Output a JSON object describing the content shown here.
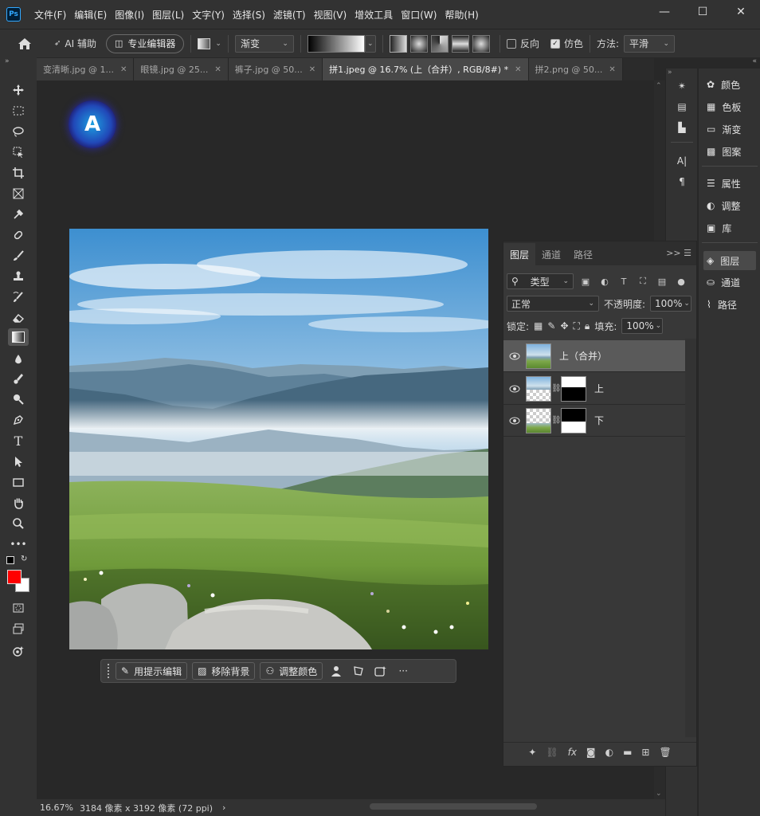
{
  "app": {
    "logo": "Ps"
  },
  "menu": [
    "文件(F)",
    "编辑(E)",
    "图像(I)",
    "图层(L)",
    "文字(Y)",
    "选择(S)",
    "滤镜(T)",
    "视图(V)",
    "增效工具",
    "窗口(W)",
    "帮助(H)"
  ],
  "window_controls": {
    "minimize": "—",
    "maximize": "☐",
    "close": "✕"
  },
  "options": {
    "ai_assist": "AI 辅助",
    "pro_editor": "专业编辑器",
    "gradient_mode": "渐变",
    "reverse": "反向",
    "reverse_checked": false,
    "dither": "仿色",
    "dither_checked": true,
    "method_label": "方法:",
    "method_value": "平滑"
  },
  "tabs": [
    {
      "label": "变清晰.jpg @ 1...",
      "active": false
    },
    {
      "label": "眼镜.jpg @ 25...",
      "active": false
    },
    {
      "label": "裤子.jpg @ 50...",
      "active": false
    },
    {
      "label": "拼1.jpeg @ 16.7% (上（合并）, RGB/8#) *",
      "active": true
    },
    {
      "label": "拼2.png @ 50...",
      "active": false
    }
  ],
  "colors": {
    "foreground": "#ff0000",
    "background": "#ffffff",
    "accent": "#31a8ff"
  },
  "ai_badge": {
    "letter": "A"
  },
  "contextual_bar": {
    "edit_with_prompt": "用提示编辑",
    "remove_background": "移除背景",
    "adjust_colors": "调整颜色",
    "more": "···"
  },
  "status": {
    "zoom": "16.67%",
    "doc_info": "3184 像素 x 3192 像素 (72 ppi)",
    "arrow": "›"
  },
  "mini_panels": {
    "group1": [
      "颜色",
      "色板",
      "渐变",
      "图案"
    ],
    "group2": [
      "属性",
      "调整",
      "库"
    ],
    "group3": [
      "图层",
      "通道",
      "路径"
    ]
  },
  "layers_panel": {
    "tabs": [
      "图层",
      "通道",
      "路径"
    ],
    "menu": ">> ☰",
    "filter_kind": "类型",
    "blend_mode": "正常",
    "opacity_label": "不透明度:",
    "opacity_value": "100%",
    "lock_label": "锁定:",
    "fill_label": "填充:",
    "fill_value": "100%",
    "layers": [
      {
        "name": "上（合并）",
        "selected": true,
        "has_mask": false
      },
      {
        "name": "上",
        "selected": false,
        "has_mask": true
      },
      {
        "name": "下",
        "selected": false,
        "has_mask": true
      }
    ]
  }
}
